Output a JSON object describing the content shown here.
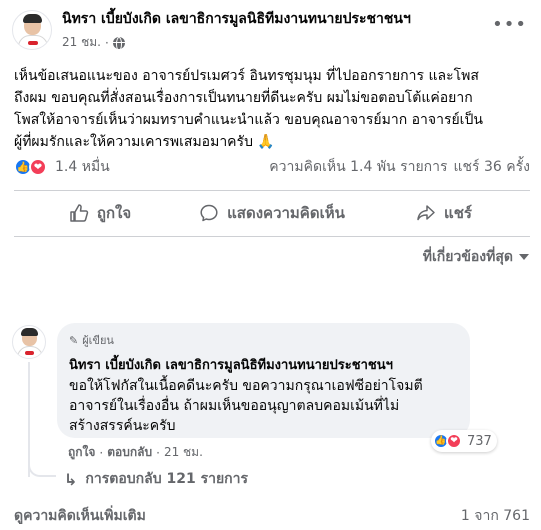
{
  "post": {
    "author": "นิทรา เบี้ยบังเกิด เลขาธิการมูลนิธิทีมงานทนายประชาชนฯ",
    "time": "21 ชม.",
    "dot": "·",
    "body_lines": [
      "เห็นข้อเสนอแนะของ อาจารย์ปรเมศวร์ อินทรชุมนุม ที่ไปออกรายการ และโพส",
      "ถึงผม ขอบคุณที่สั่งสอนเรื่องการเป็นทนายที่ดีนะครับ ผมไม่ขอตอบโต้แค่อยาก",
      "โพสให้อาจารย์เห็นว่าผมทราบคำแนะนำแล้ว ขอบคุณอาจารย์มาก อาจารย์เป็น",
      "ผู้ที่ผมรักและให้ความเคารพเสมอมาครับ 🙏"
    ],
    "reactions_count": "1.4 หมื่น",
    "comments_count": "ความคิดเห็น 1.4 พัน รายการ",
    "shares_count": "แชร์ 36 ครั้ง"
  },
  "actions": {
    "like": "ถูกใจ",
    "comment": "แสดงความคิดเห็น",
    "share": "แชร์"
  },
  "filter": {
    "label": "ที่เกี่ยวข้องที่สุด"
  },
  "comment": {
    "badge": "ผู้เขียน",
    "author": "นิทรา เบี้ยบังเกิด เลขาธิการมูลนิธิทีมงานทนายประชาชนฯ",
    "text_lines": [
      "ขอให้โฟกัสในเนื้อคดีนะครับ ขอความกรุณาเอฟซีอย่าโจมตี",
      "อาจารย์ในเรื่องอื่น ถ้าผมเห็นขออนุญาตลบคอมเม้นที่ไม่",
      "สร้างสรรค์นะครับ"
    ],
    "reactions_count": "737",
    "like_label": "ถูกใจ",
    "reply_label": "ตอบกลับ",
    "time": "21 ชม.",
    "dot": "·",
    "replies_label": "การตอบกลับ 121 รายการ"
  },
  "footer": {
    "more_comments": "ดูความคิดเห็นเพิ่มเติม",
    "page_count": "1 จาก 761"
  },
  "colors": {
    "like_blue": "#1877f2",
    "love_red": "#f33e58",
    "secondary_text": "#65676b",
    "bubble_bg": "#f0f2f5"
  }
}
